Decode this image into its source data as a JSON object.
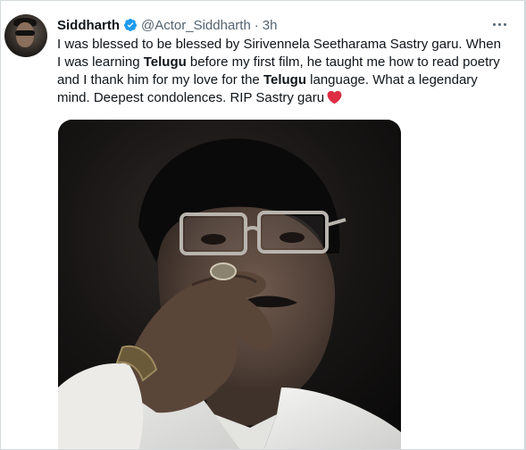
{
  "tweet": {
    "author_name": "Siddharth",
    "handle": "@Actor_Siddharth",
    "separator": "·",
    "time": "3h",
    "verified": true,
    "text_1": "I was blessed to be blessed by Sirivennela Seetharama Sastry garu. When I was learning ",
    "highlight_1": "Telugu",
    "text_2": " before my first film, he taught me how to read poetry and I thank him for my love for the ",
    "highlight_2": "Telugu",
    "text_3": " language. What a legendary mind. Deepest condolences. RIP Sastry garu",
    "emoji": "red-heart-icon"
  },
  "colors": {
    "verified_blue": "#1d9bf0",
    "secondary_text": "#536471",
    "heart_red": "#dd2e44"
  }
}
